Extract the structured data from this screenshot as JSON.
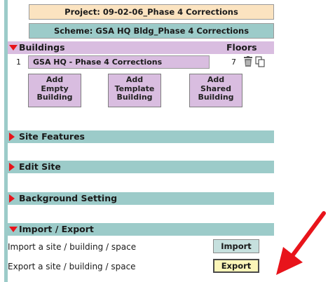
{
  "header": {
    "project": "Project: 09-02-06_Phase 4 Corrections",
    "scheme": "Scheme: GSA HQ Bldg_Phase 4 Corrections"
  },
  "buildings": {
    "title": "Buildings",
    "floors_header": "Floors",
    "items": [
      {
        "index": "1",
        "name": "GSA HQ - Phase 4 Corrections",
        "floors": "7"
      }
    ],
    "add_buttons": [
      {
        "line1": "Add",
        "line2": "Empty",
        "line3": "Building"
      },
      {
        "line1": "Add",
        "line2": "Template",
        "line3": "Building"
      },
      {
        "line1": "Add",
        "line2": "Shared",
        "line3": "Building"
      }
    ]
  },
  "sections": {
    "site_features": "Site Features",
    "edit_site": "Edit Site",
    "background_setting": "Background Setting",
    "import_export": "Import / Export"
  },
  "import_export": {
    "import_label": "Import a site / building / space",
    "import_button": "Import",
    "export_label": "Export a site / building / space",
    "export_button": "Export"
  },
  "colors": {
    "teal_bar": "#9ccbc9",
    "lavender_bar": "#d9bde0",
    "project_bg": "#fbe3c0",
    "export_bg": "#fbf5b8",
    "arrow": "#e8141b"
  }
}
